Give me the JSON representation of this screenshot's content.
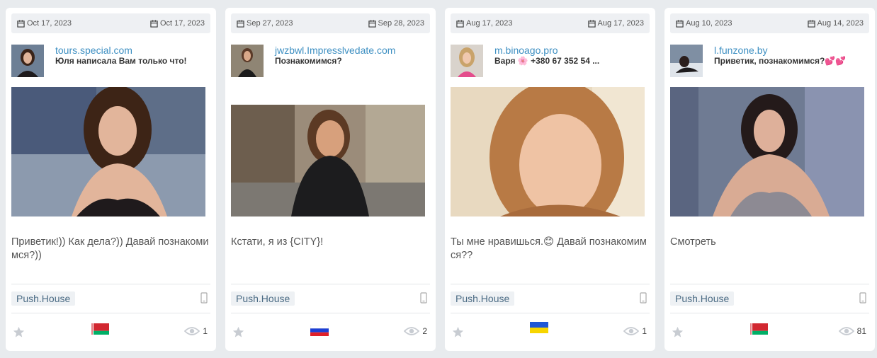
{
  "cards": [
    {
      "date_start": "Oct 17, 2023",
      "date_end": "Oct 17, 2023",
      "domain": "tours.special.com",
      "title": "Юля написала Вам только что!",
      "description": "Приветик!)) Как дела?)) Давай познакомимся?))",
      "network": "Push.House",
      "country_flag": "Belarus",
      "views": "1"
    },
    {
      "date_start": "Sep 27, 2023",
      "date_end": "Sep 28, 2023",
      "domain": "jwzbwl.Impresslvedate.com",
      "title": "Познакомимся?",
      "description": "Кстати, я из {CITY}!",
      "network": "Push.House",
      "country_flag": "Russia",
      "views": "2"
    },
    {
      "date_start": "Aug 17, 2023",
      "date_end": "Aug 17, 2023",
      "domain": "m.binoago.pro",
      "title": "Варя 🌸 +380 67 352 54 ...",
      "description": "Ты мне нравишься.😊 Давай познакомимся??",
      "network": "Push.House",
      "country_flag": "Ukraine",
      "views": "1"
    },
    {
      "date_start": "Aug 10, 2023",
      "date_end": "Aug 14, 2023",
      "domain": "l.funzone.by",
      "title": "Приветик, познакомимся?💕💕",
      "description": "Смотреть",
      "network": "Push.House",
      "country_flag": "Belarus",
      "views": "81"
    }
  ],
  "colors": {
    "accent_link": "#3d8fc2",
    "tag_bg": "#eef1f4",
    "page_bg": "#e8ebee"
  },
  "icons": {
    "date": "calendar-icon",
    "device": "mobile-phone-icon",
    "favorite": "star-icon",
    "views": "eye-icon"
  }
}
